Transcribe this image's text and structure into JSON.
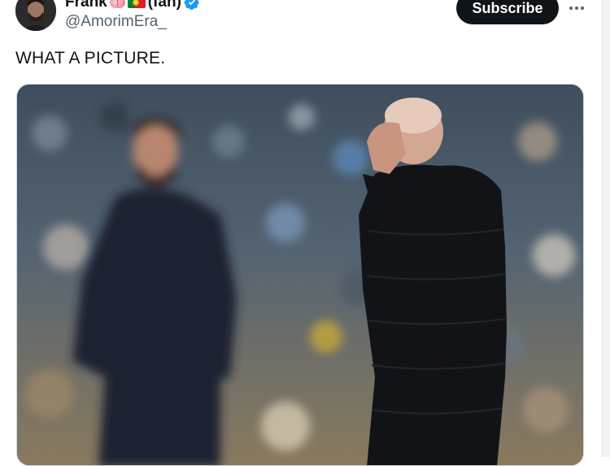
{
  "tweet": {
    "display_name": "Frank",
    "name_suffix": "(fan)",
    "handle": "@AmorimEra_",
    "text": "WHAT A PICTURE.",
    "subscribe_label": "Subscribe",
    "emojis": [
      "brain-icon",
      "portugal-flag-icon"
    ],
    "verified": true
  },
  "colors": {
    "subscribe_bg": "#0f1419",
    "verified_blue": "#1d9bf0",
    "handle_gray": "#536471"
  }
}
